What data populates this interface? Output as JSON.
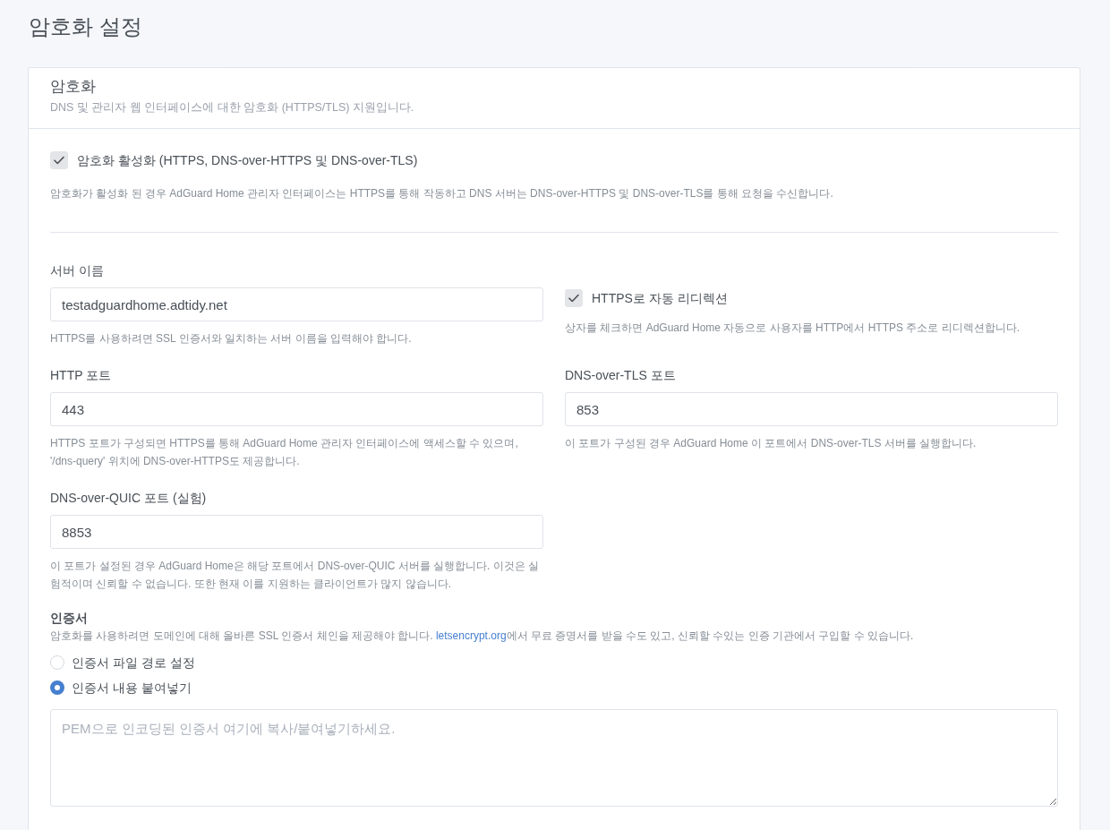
{
  "page_title": "암호화 설정",
  "card": {
    "title": "암호화",
    "subtitle": "DNS 및 관리자 웹 인터페이스에 대한 암호화 (HTTPS/TLS) 지원입니다."
  },
  "encryption": {
    "label": "암호화 활성화 (HTTPS, DNS-over-HTTPS 및 DNS-over-TLS)",
    "checked": true,
    "description": "암호화가 활성화 된 경우 AdGuard Home 관리자 인터페이스는 HTTPS를 통해 작동하고 DNS 서버는 DNS-over-HTTPS 및 DNS-over-TLS를 통해 요청을 수신합니다."
  },
  "fields": [
    {
      "kind": "input",
      "label": "서버 이름",
      "value": "testadguardhome.adtidy.net",
      "help": "HTTPS를 사용하려면 SSL 인증서와 일치하는 서버 이름을 입력해야 합니다."
    },
    {
      "kind": "checkbox",
      "label": "HTTPS로 자동 리디렉션",
      "checked": true,
      "help": "상자를 체크하면 AdGuard Home 자동으로 사용자를 HTTP에서 HTTPS 주소로 리디렉션합니다."
    },
    {
      "kind": "input",
      "label": "HTTP 포트",
      "value": "443",
      "help": "HTTPS 포트가 구성되면 HTTPS를 통해 AdGuard Home 관리자 인터페이스에 액세스할 수 있으며, '/dns-query' 위치에 DNS-over-HTTPS도 제공합니다."
    },
    {
      "kind": "input",
      "label": "DNS-over-TLS 포트",
      "value": "853",
      "help": "이 포트가 구성된 경우 AdGuard Home 이 포트에서 DNS-over-TLS 서버를 실행합니다."
    },
    {
      "kind": "input",
      "label": "DNS-over-QUIC 포트 (실험)",
      "value": "8853",
      "help": "이 포트가 설정된 경우 AdGuard Home은 해당 포트에서 DNS-over-QUIC 서버를 실행합니다. 이것은 실험적이며 신뢰할 수 없습니다. 또한 현재 이를 지원하는 클라이언트가 많지 않습니다."
    }
  ],
  "certificate": {
    "title": "인증서",
    "description": [
      {
        "kind": "text",
        "text": "암호화를 사용하려면 도메인에 대해 올바른 SSL 인증서 체인을 제공해야 합니다. "
      },
      {
        "kind": "link",
        "text": "letsencrypt.org"
      },
      {
        "kind": "text",
        "text": "에서 무료 증명서를 받을 수도 있고, 신뢰할 수있는 인증 기관에서 구입할 수 있습니다."
      }
    ],
    "options": [
      {
        "label": "인증서 파일 경로 설정",
        "selected": false
      },
      {
        "label": "인증서 내용 붙여넣기",
        "selected": true
      }
    ],
    "textarea": {
      "placeholder": "PEM으로 인코딩된 인증서 여기에 복사/붙여넣기하세요."
    }
  }
}
